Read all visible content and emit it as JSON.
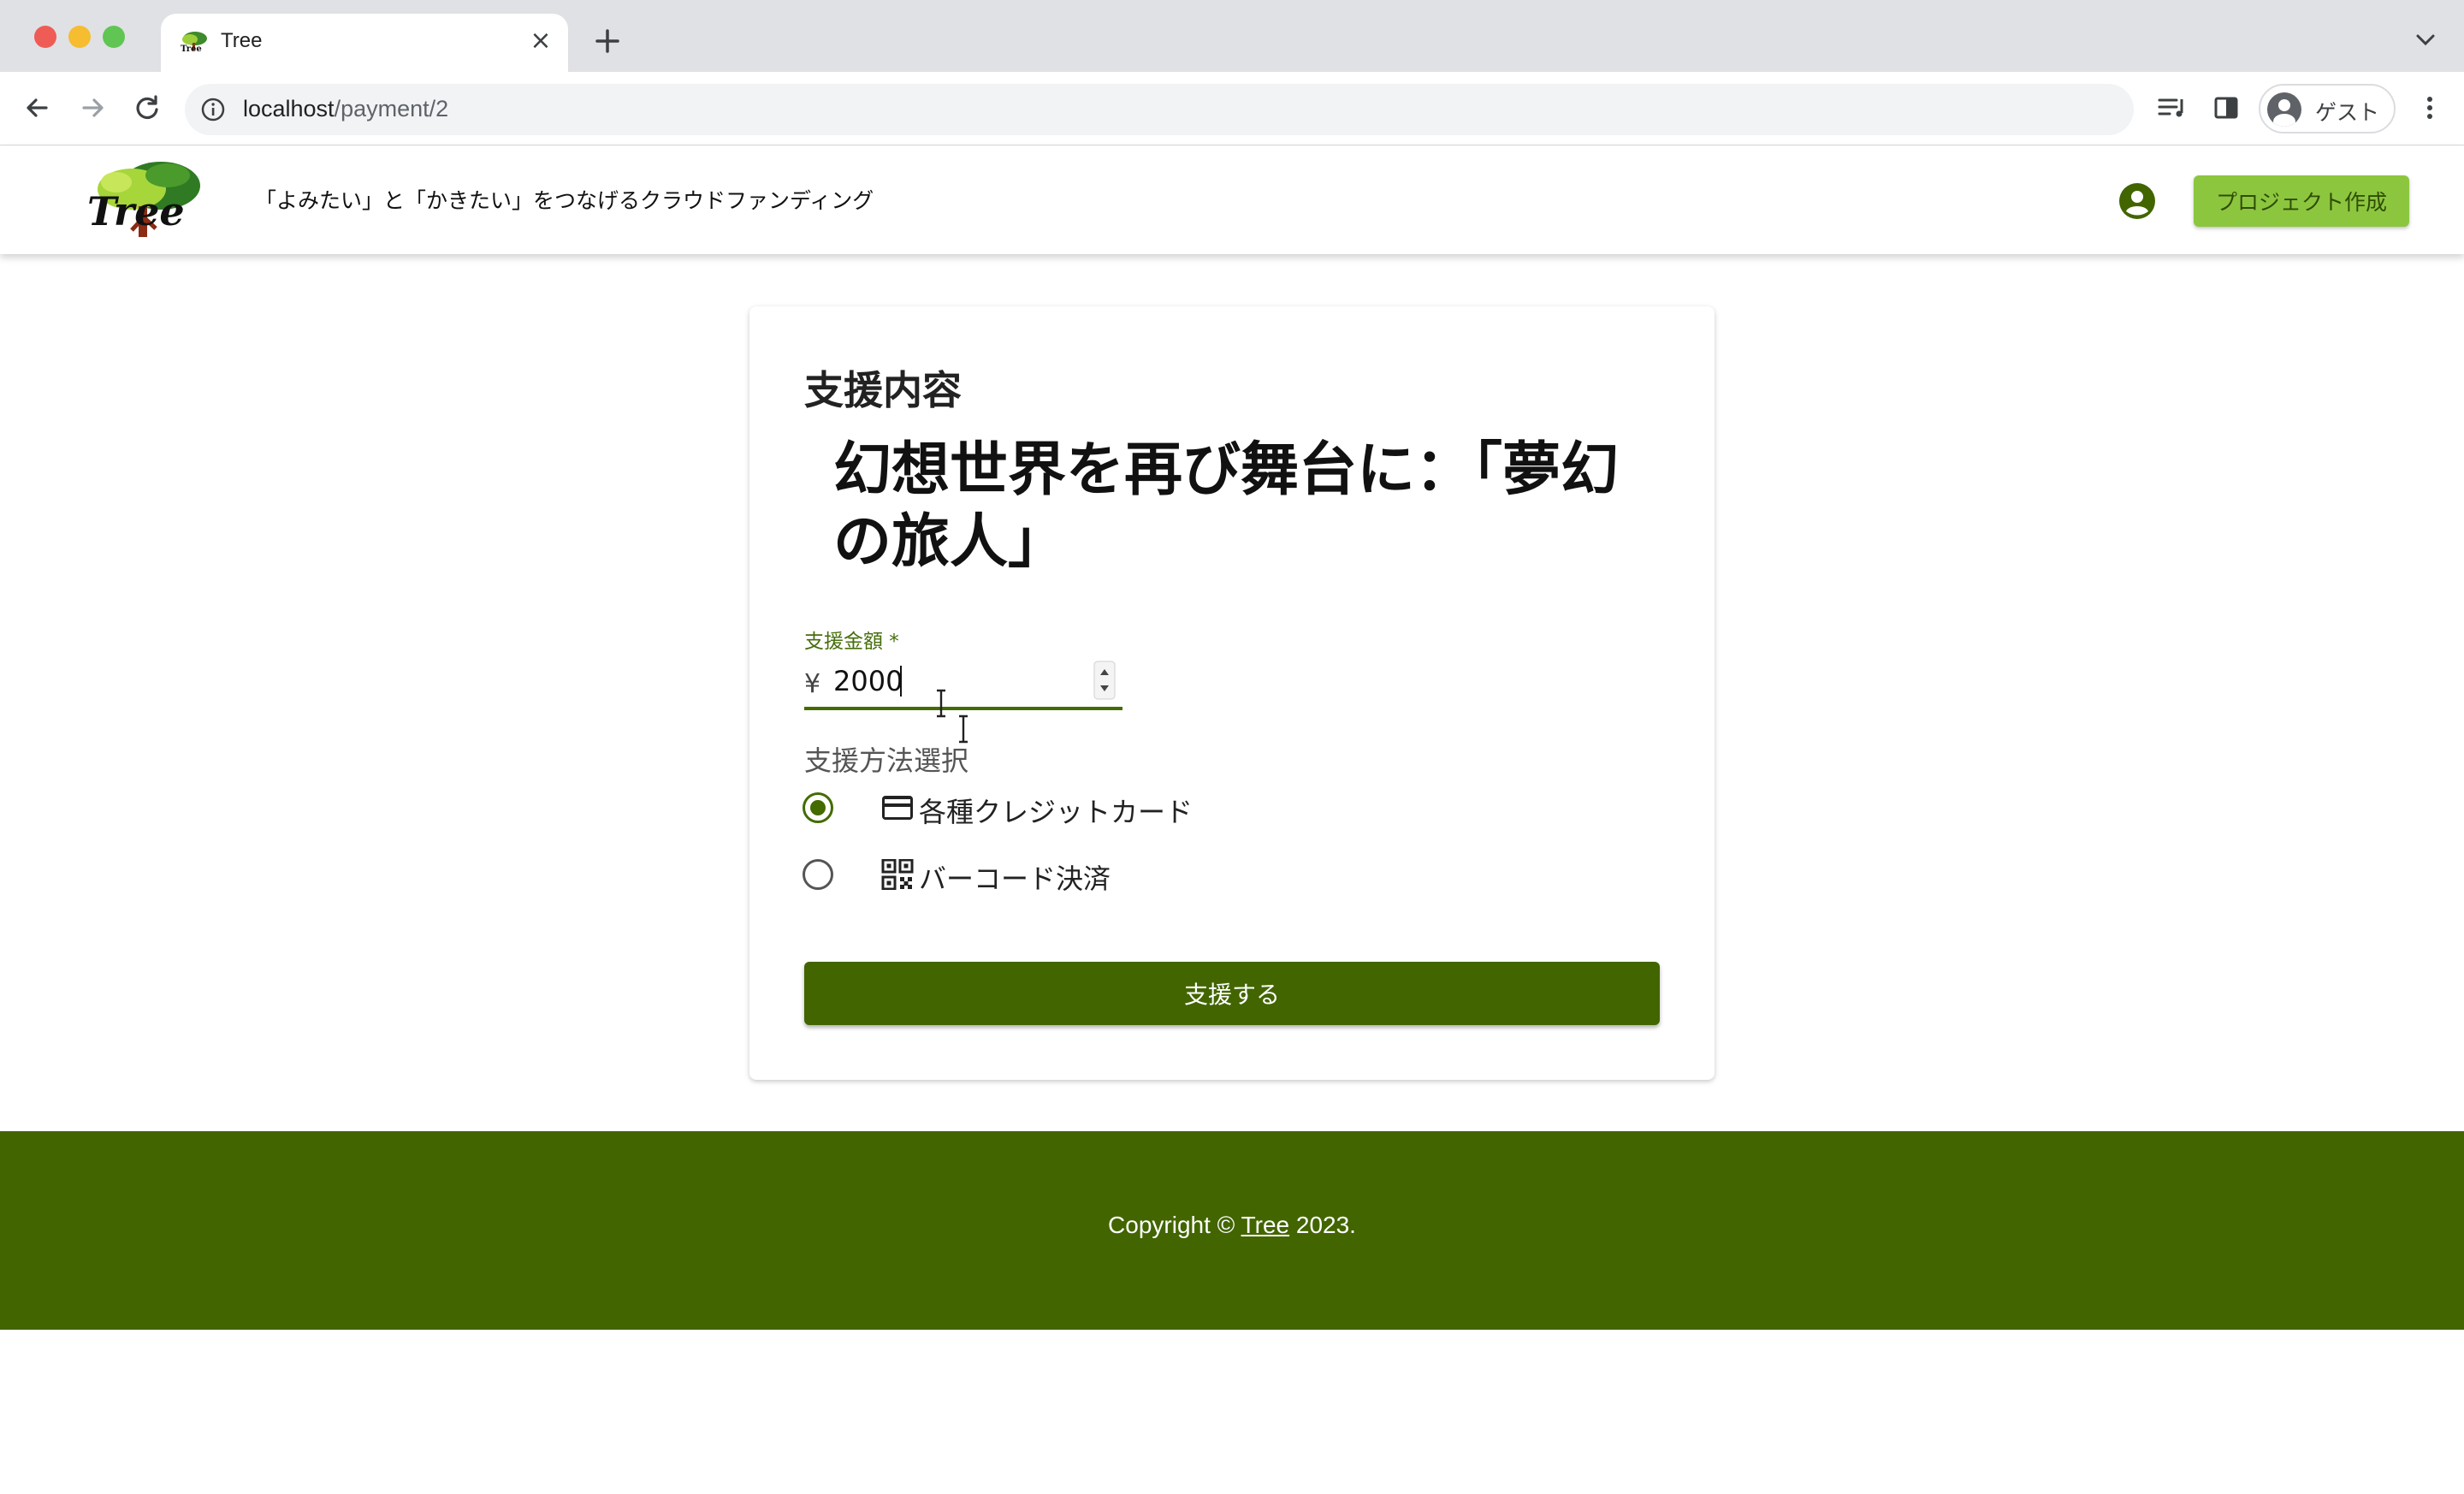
{
  "browser": {
    "tab_title": "Tree",
    "tab_close": "×",
    "url_host": "localhost",
    "url_path": "/payment/2",
    "profile_label": "ゲスト"
  },
  "header": {
    "tagline": "「よみたい」と「かきたい」をつなげるクラウドファンディング",
    "create_button": "プロジェクト作成"
  },
  "card": {
    "heading": "支援内容",
    "project_title": "幻想世界を再び舞台に：「夢幻の旅人」",
    "amount_label": "支援金額 *",
    "currency": "¥",
    "amount_value": "2000",
    "method_label": "支援方法選択",
    "methods": [
      {
        "label": "各種クレジットカード",
        "icon": "credit-card-icon",
        "selected": true
      },
      {
        "label": "バーコード決済",
        "icon": "qr-code-icon",
        "selected": false
      }
    ],
    "submit_button": "支援する"
  },
  "footer": {
    "prefix": "Copyright © ",
    "link": "Tree",
    "suffix": " 2023."
  },
  "colors": {
    "brand_dark_green": "#426500",
    "accent_light_green": "#8cc63f",
    "label_green": "#466e0c"
  }
}
